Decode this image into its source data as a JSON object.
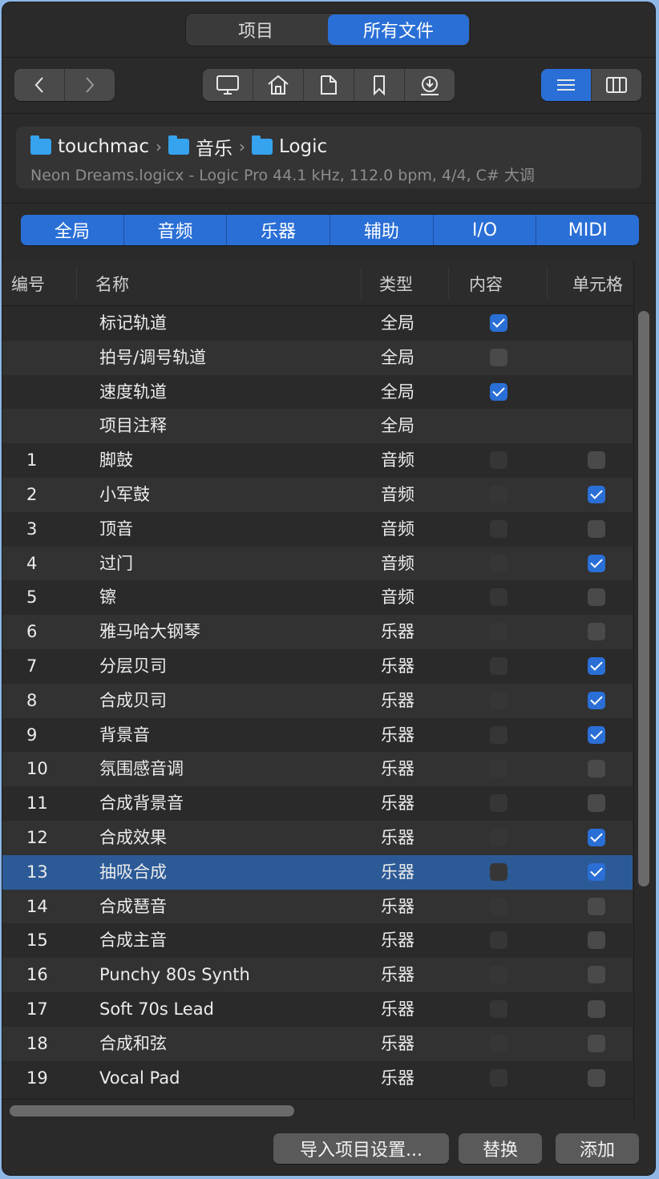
{
  "tabs": {
    "project": "项目",
    "all_files": "所有文件"
  },
  "breadcrumb": [
    {
      "label": "touchmac",
      "icon": "home-folder-icon"
    },
    {
      "label": "音乐",
      "icon": "music-folder-icon"
    },
    {
      "label": "Logic",
      "icon": "folder-icon"
    }
  ],
  "breadcrumb_sep": "›",
  "file_info": "Neon Dreams.logicx - Logic Pro 44.1 kHz, 112.0 bpm, 4/4, C# 大调",
  "filters": [
    "全局",
    "音频",
    "乐器",
    "辅助",
    "I/O",
    "MIDI"
  ],
  "columns": {
    "num": "编号",
    "name": "名称",
    "type": "类型",
    "content": "内容",
    "cells": "单元格"
  },
  "rows": [
    {
      "num": "",
      "name": "标记轨道",
      "type": "全局",
      "content": "on",
      "cell": "none"
    },
    {
      "num": "",
      "name": "拍号/调号轨道",
      "type": "全局",
      "content": "off",
      "cell": "none"
    },
    {
      "num": "",
      "name": "速度轨道",
      "type": "全局",
      "content": "on",
      "cell": "none"
    },
    {
      "num": "",
      "name": "项目注释",
      "type": "全局",
      "content": "none",
      "cell": "none"
    },
    {
      "num": "1",
      "name": "脚鼓",
      "type": "音频",
      "content": "dis",
      "cell": "off"
    },
    {
      "num": "2",
      "name": "小军鼓",
      "type": "音频",
      "content": "dis",
      "cell": "on"
    },
    {
      "num": "3",
      "name": "顶音",
      "type": "音频",
      "content": "dis",
      "cell": "off"
    },
    {
      "num": "4",
      "name": "过门",
      "type": "音频",
      "content": "dis",
      "cell": "on"
    },
    {
      "num": "5",
      "name": "镲",
      "type": "音频",
      "content": "dis",
      "cell": "off"
    },
    {
      "num": "6",
      "name": "雅马哈大钢琴",
      "type": "乐器",
      "content": "dis",
      "cell": "off"
    },
    {
      "num": "7",
      "name": "分层贝司",
      "type": "乐器",
      "content": "dis",
      "cell": "on"
    },
    {
      "num": "8",
      "name": "合成贝司",
      "type": "乐器",
      "content": "dis",
      "cell": "on"
    },
    {
      "num": "9",
      "name": "背景音",
      "type": "乐器",
      "content": "dis",
      "cell": "on"
    },
    {
      "num": "10",
      "name": "氛围感音调",
      "type": "乐器",
      "content": "dis",
      "cell": "off"
    },
    {
      "num": "11",
      "name": "合成背景音",
      "type": "乐器",
      "content": "dis",
      "cell": "off"
    },
    {
      "num": "12",
      "name": "合成效果",
      "type": "乐器",
      "content": "dis",
      "cell": "on"
    },
    {
      "num": "13",
      "name": "抽吸合成",
      "type": "乐器",
      "content": "dis",
      "cell": "on",
      "selected": true
    },
    {
      "num": "14",
      "name": "合成琶音",
      "type": "乐器",
      "content": "dis",
      "cell": "off"
    },
    {
      "num": "15",
      "name": "合成主音",
      "type": "乐器",
      "content": "dis",
      "cell": "off"
    },
    {
      "num": "16",
      "name": "Punchy 80s Synth",
      "type": "乐器",
      "content": "dis",
      "cell": "off"
    },
    {
      "num": "17",
      "name": "Soft 70s Lead",
      "type": "乐器",
      "content": "dis",
      "cell": "off"
    },
    {
      "num": "18",
      "name": "合成和弦",
      "type": "乐器",
      "content": "dis",
      "cell": "off"
    },
    {
      "num": "19",
      "name": "Vocal Pad",
      "type": "乐器",
      "content": "dis",
      "cell": "off"
    }
  ],
  "buttons": {
    "import": "导入项目设置...",
    "replace": "替换",
    "add": "添加"
  },
  "colors": {
    "accent": "#2a6fd6",
    "selected_row": "#2c5a96",
    "folder": "#36a3ef"
  }
}
